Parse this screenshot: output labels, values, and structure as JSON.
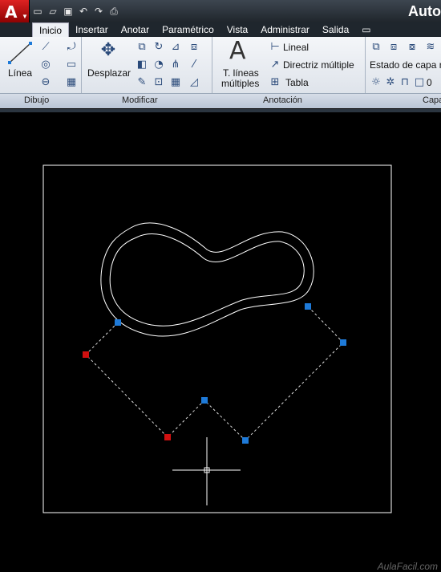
{
  "app": {
    "title": "Auto",
    "logo": "A"
  },
  "quick_access": {
    "icons": [
      "new-icon",
      "open-icon",
      "save-icon",
      "undo-icon",
      "redo-icon",
      "print-icon"
    ]
  },
  "tabs": [
    "Inicio",
    "Insertar",
    "Anotar",
    "Paramétrico",
    "Vista",
    "Administrar",
    "Salida"
  ],
  "ribbon": {
    "dibujo": {
      "panel_label": "Dibujo",
      "linea": "Línea"
    },
    "modificar": {
      "panel_label": "Modificar",
      "desplazar": "Desplazar"
    },
    "anotacion": {
      "panel_label": "Anotación",
      "text_line1": "T. líneas",
      "text_line2": "múltiples",
      "lineal": "Lineal",
      "directriz": "Directriz múltiple",
      "tabla": "Tabla"
    },
    "capas": {
      "panel_label": "Capa",
      "estado": "Estado de capa n",
      "layer_value": "0"
    }
  },
  "watermark": "AulaFacil.com",
  "colors": {
    "grip_blue": "#1e7ad8",
    "grip_red": "#d01010",
    "canvas": "#000000"
  }
}
